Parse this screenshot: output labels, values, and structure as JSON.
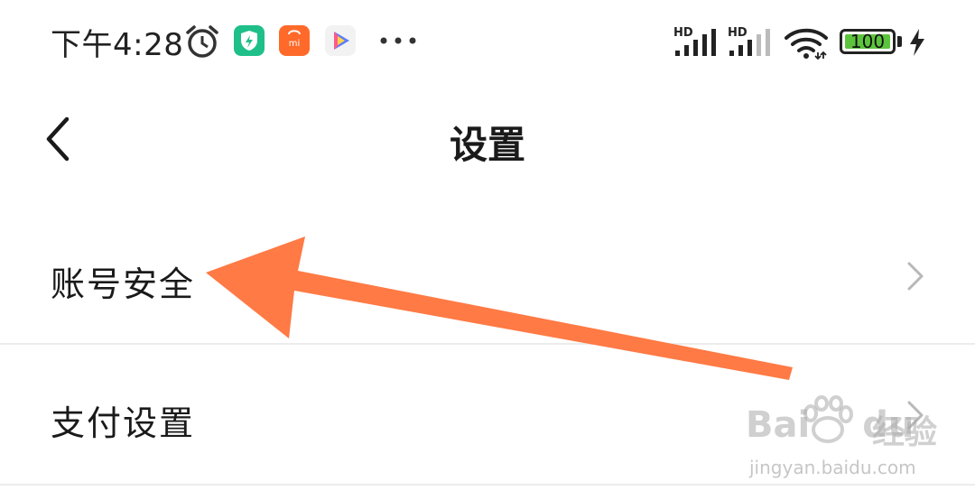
{
  "status_bar": {
    "time": "下午4:28",
    "icons": [
      "alarm-icon",
      "security-app-icon",
      "mi-store-app-icon",
      "video-app-icon",
      "more-notifications-icon",
      "hd-signal-icon",
      "hd-signal-icon",
      "wifi-icon",
      "battery-icon",
      "charging-icon"
    ],
    "signal1_label": "HD",
    "signal2_label": "HD",
    "battery_level": "100",
    "battery_color": "#5cc43c"
  },
  "header": {
    "title": "设置",
    "back_icon": "chevron-left-icon"
  },
  "settings": {
    "items": [
      {
        "label": "账号安全",
        "icon": "chevron-right-icon"
      },
      {
        "label": "支付设置",
        "icon": "chevron-right-icon"
      }
    ]
  },
  "annotation": {
    "type": "arrow",
    "color": "#ff7a45",
    "points_to": "账号安全"
  },
  "watermark": {
    "brand_latin": "Bai",
    "brand_latin2": "du",
    "brand_cn": "经验",
    "url": "jingyan.baidu.com"
  }
}
